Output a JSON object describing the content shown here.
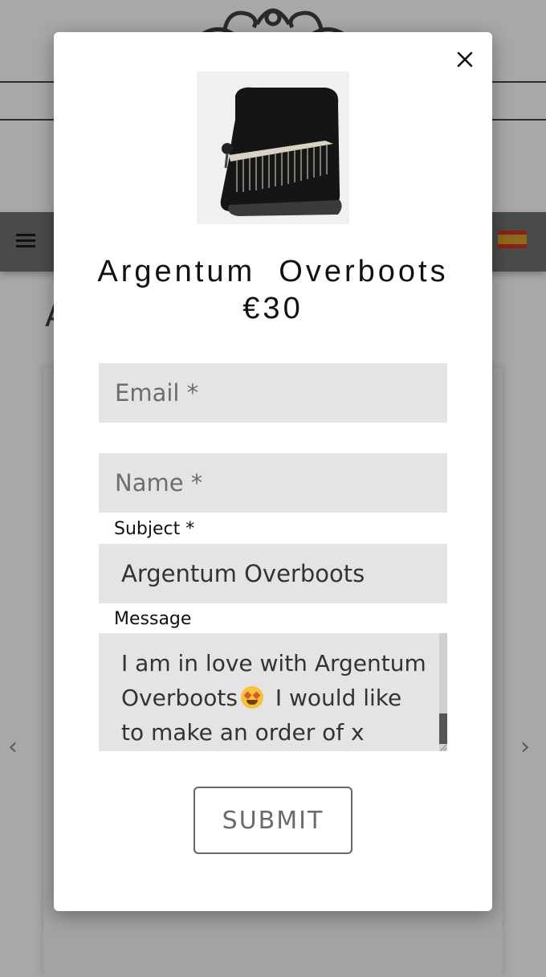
{
  "background": {
    "page_title_fragment": "A",
    "prev_arrow": "‹",
    "next_arrow": "›"
  },
  "modal": {
    "product": {
      "name_line": "Argentum  Overboots",
      "price": "€30"
    },
    "form": {
      "email_placeholder": "Email *",
      "name_placeholder": "Name *",
      "subject_label": "Subject *",
      "subject_value": "Argentum Overboots",
      "message_label": "Message",
      "message_part1": "I am in love with Argentum Overboots",
      "message_part2": " I would like to make an order of x",
      "submit_label": "SUBMIT"
    }
  },
  "colors": {
    "overlay": "#a8a8a8",
    "field_bg": "#e6e3e4",
    "nav_bg": "#4a4a4a"
  },
  "icons": {
    "close": "close-icon",
    "menu": "hamburger-menu-icon",
    "flag": "spain-flag-icon",
    "emoji": "star-struck-emoji"
  }
}
